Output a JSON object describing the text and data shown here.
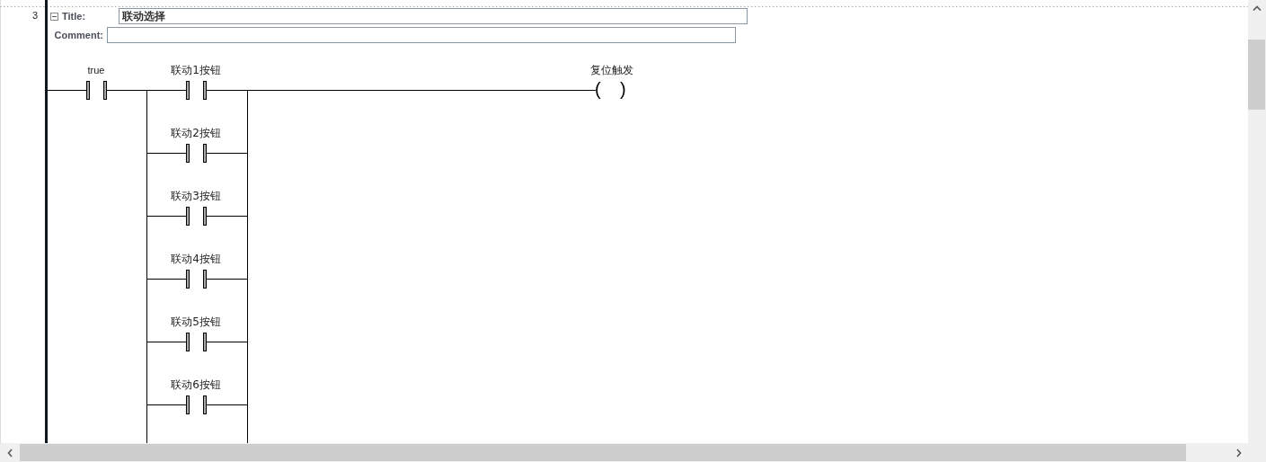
{
  "network": {
    "number": "3",
    "title_label": "Title:",
    "title": "联动选择",
    "comment_label": "Comment:"
  },
  "rung": {
    "contact": {
      "label": "true"
    },
    "parallel_contacts": [
      {
        "label": "联动1按钮"
      },
      {
        "label": "联动2按钮"
      },
      {
        "label": "联动3按钮"
      },
      {
        "label": "联动4按钮"
      },
      {
        "label": "联动5按钮"
      },
      {
        "label": "联动6按钮"
      }
    ],
    "coil": {
      "label": "复位触发",
      "open": "(",
      "close": ")"
    }
  }
}
